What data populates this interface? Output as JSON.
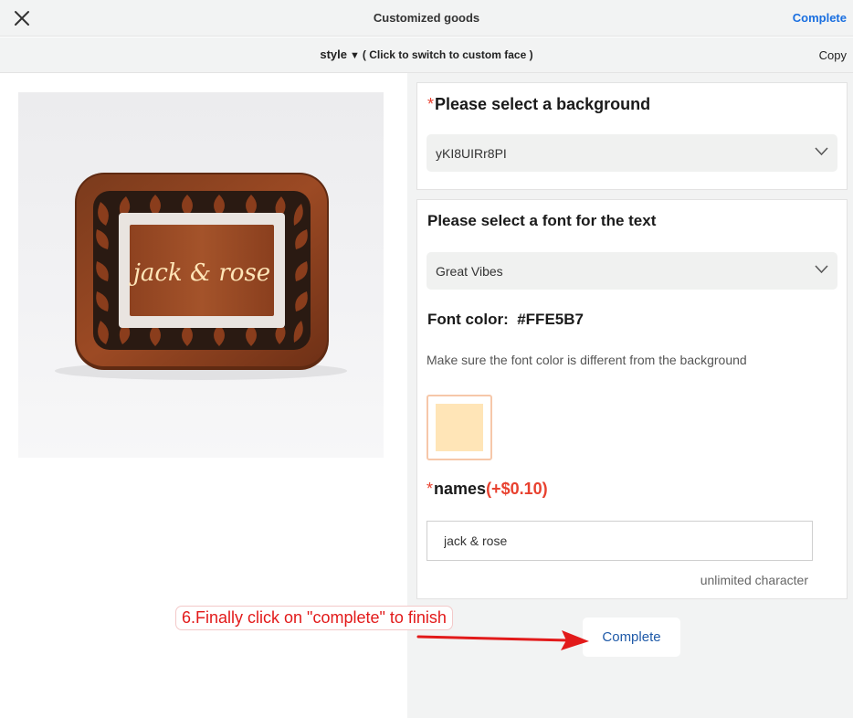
{
  "header": {
    "title": "Customized goods",
    "complete_label": "Complete"
  },
  "style_bar": {
    "style_label": "style",
    "hint": "( Click to switch to custom face )",
    "copy_label": "Copy"
  },
  "preview": {
    "engraved_text": "jack & rose"
  },
  "background_section": {
    "label": "Please select a background",
    "selected_value": "yKI8UIRr8PI"
  },
  "font_section": {
    "label": "Please select a font for the text",
    "selected_font": "Great Vibes",
    "color_label": "Font color:",
    "color_value": "#FFE5B7",
    "note": "Make sure the font color is different from the background"
  },
  "names_section": {
    "label": "names",
    "price": "(+$0.10)",
    "value": "jack & rose",
    "limit_text": "unlimited character"
  },
  "footer": {
    "complete_label": "Complete"
  },
  "annotation": {
    "text": "6.Finally click on \"complete\" to finish"
  },
  "colors": {
    "accent": "#1a6fe0",
    "required": "#e8412f",
    "swatch": "#FFE5B7",
    "annotation": "#e21a1a"
  }
}
